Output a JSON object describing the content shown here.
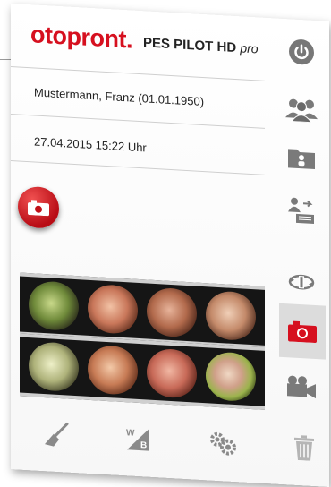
{
  "header": {
    "logo": "otopront.",
    "product_name": "PES PILOT HD",
    "product_suffix": "pro"
  },
  "patient": {
    "name": "Mustermann, Franz (01.01.1950)"
  },
  "session": {
    "datetime": "27.04.2015  15:22 Uhr"
  },
  "icons": {
    "power": "power-icon",
    "patients": "users-icon",
    "folder": "patient-folder-icon",
    "transfer": "transfer-icon",
    "rotate": "rotate-icon",
    "photo_mode": "camera-icon",
    "video_mode": "video-camera-icon",
    "clean": "clean-brush-icon",
    "white_balance": "white-balance-icon",
    "settings": "settings-gears-icon",
    "delete": "trash-icon",
    "capture": "capture-camera-icon"
  },
  "gallery": {
    "rows": [
      [
        {
          "name": "thumb-1",
          "tone": "#6f8a3a"
        },
        {
          "name": "thumb-2",
          "tone": "#c9775a"
        },
        {
          "name": "thumb-3",
          "tone": "#b26a4c"
        },
        {
          "name": "thumb-4",
          "tone": "#c48a6a"
        }
      ],
      [
        {
          "name": "thumb-5",
          "tone": "#aeb27a"
        },
        {
          "name": "thumb-6",
          "tone": "#c77b55"
        },
        {
          "name": "thumb-7",
          "tone": "#c86a58"
        },
        {
          "name": "thumb-8",
          "tone": "#9bb34c"
        }
      ]
    ]
  },
  "colors": {
    "brand": "#d6101f",
    "icon_gray": "#7a7a7a",
    "selected_bg": "#dcdcdc"
  }
}
